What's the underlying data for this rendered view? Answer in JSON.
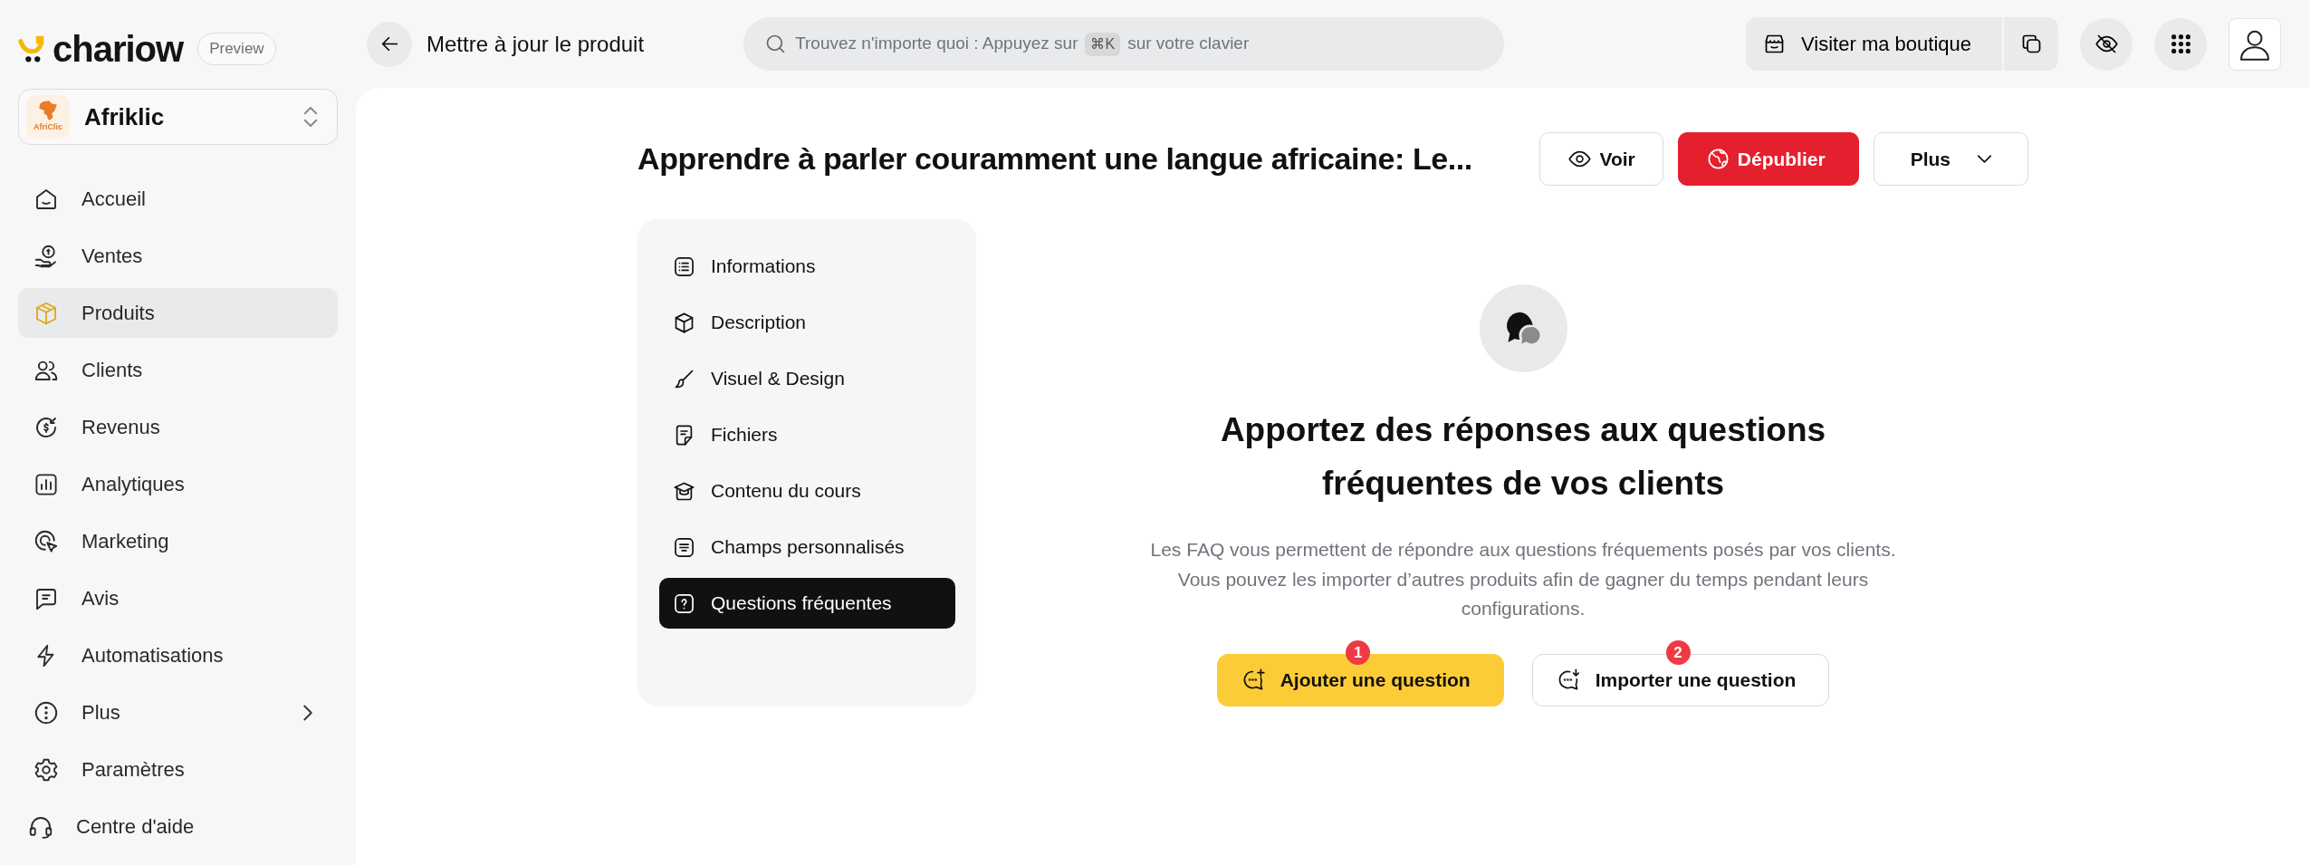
{
  "brand": {
    "name": "chariow",
    "badge": "Preview"
  },
  "store": {
    "name": "Afriklic",
    "logo_text": "AfriClic"
  },
  "nav": [
    {
      "label": "Accueil",
      "selected": false,
      "submenu": false
    },
    {
      "label": "Ventes",
      "selected": false,
      "submenu": false
    },
    {
      "label": "Produits",
      "selected": true,
      "submenu": false
    },
    {
      "label": "Clients",
      "selected": false,
      "submenu": false
    },
    {
      "label": "Revenus",
      "selected": false,
      "submenu": false
    },
    {
      "label": "Analytiques",
      "selected": false,
      "submenu": false
    },
    {
      "label": "Marketing",
      "selected": false,
      "submenu": false
    },
    {
      "label": "Avis",
      "selected": false,
      "submenu": false
    },
    {
      "label": "Automatisations",
      "selected": false,
      "submenu": false
    },
    {
      "label": "Plus",
      "selected": false,
      "submenu": true
    },
    {
      "label": "Paramètres",
      "selected": false,
      "submenu": false
    }
  ],
  "help": {
    "label": "Centre d'aide"
  },
  "topbar": {
    "title": "Mettre à jour le produit",
    "search": {
      "text_before": "Trouvez n'importe quoi : Appuyez sur",
      "shortcut": "⌘K",
      "text_after": "sur votre clavier"
    },
    "shop_button": "Visiter ma boutique"
  },
  "product": {
    "title": "Apprendre à parler couramment une langue africaine: Le...",
    "actions": [
      {
        "label": "Voir",
        "kind": "view"
      },
      {
        "label": "Dépublier",
        "kind": "danger"
      },
      {
        "label": "Plus",
        "kind": "dropdown"
      }
    ]
  },
  "tabs": [
    {
      "label": "Informations",
      "selected": false
    },
    {
      "label": "Description",
      "selected": false
    },
    {
      "label": "Visuel & Design",
      "selected": false
    },
    {
      "label": "Fichiers",
      "selected": false
    },
    {
      "label": "Contenu du cours",
      "selected": false
    },
    {
      "label": "Champs personnalisés",
      "selected": false
    },
    {
      "label": "Questions fréquentes",
      "selected": true
    }
  ],
  "empty_state": {
    "heading": "Apportez des réponses aux questions fréquentes de vos clients",
    "description": "Les FAQ vous permettent de répondre aux questions fréquements posés par vos clients. Vous pouvez les importer d’autres produits afin de gagner du temps pendant leurs configurations.",
    "buttons": [
      {
        "label": "Ajouter une question",
        "kind": "primary",
        "badge": "1"
      },
      {
        "label": "Importer une question",
        "kind": "outline",
        "badge": "2"
      }
    ]
  }
}
